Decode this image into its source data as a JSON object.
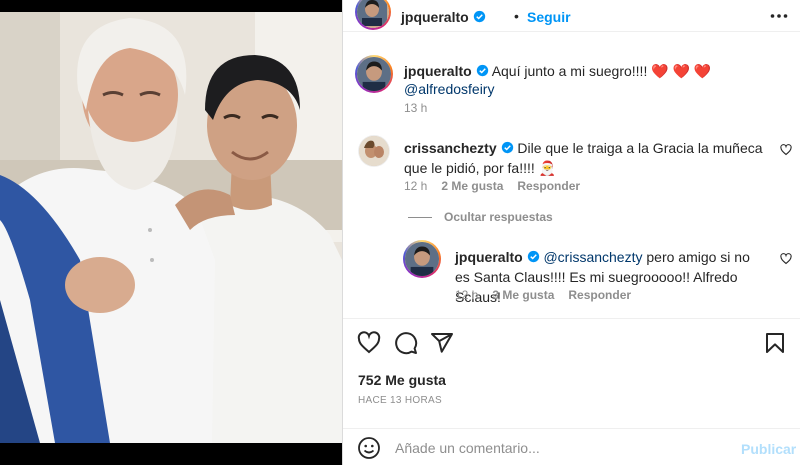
{
  "post": {
    "author": "jpqueralto",
    "follow_label": "Seguir",
    "dot": "•"
  },
  "caption": {
    "author": "jpqueralto",
    "text": "Aquí junto a mi suegro!!!! ❤️ ❤️ ❤️",
    "mention": "@alfredosfeiry",
    "time": "13 h"
  },
  "comments": [
    {
      "author": "crissanchezty",
      "text": "Dile que le traiga a la Gracia la muñeca que le pidió, por fa!!!! 🎅",
      "time": "12 h",
      "likes": "2 Me gusta",
      "reply_label": "Responder"
    }
  ],
  "hide_replies_label": "Ocultar respuestas",
  "replies": [
    {
      "author": "jpqueralto",
      "mention": "@crissanchezty",
      "text": " pero amigo si no es Santa Claus!!!! Es mi suegrooooo!! Alfredo Sclaus!",
      "time": "12 h",
      "likes": "3 Me gusta",
      "reply_label": "Responder"
    }
  ],
  "stats": {
    "likes": "752 Me gusta",
    "time_ago": "HACE 13 HORAS"
  },
  "comment_input": {
    "placeholder": "Añade un comentario...",
    "publish_label": "Publicar"
  },
  "colors": {
    "accent": "#0095f6",
    "publish_disabled": "#b2dffc",
    "mention": "#00376b",
    "muted": "#8e8e8e"
  },
  "icons": [
    "more-options-icon",
    "heart-icon",
    "comment-icon",
    "share-icon",
    "save-icon",
    "emoji-icon",
    "verified-icon"
  ]
}
